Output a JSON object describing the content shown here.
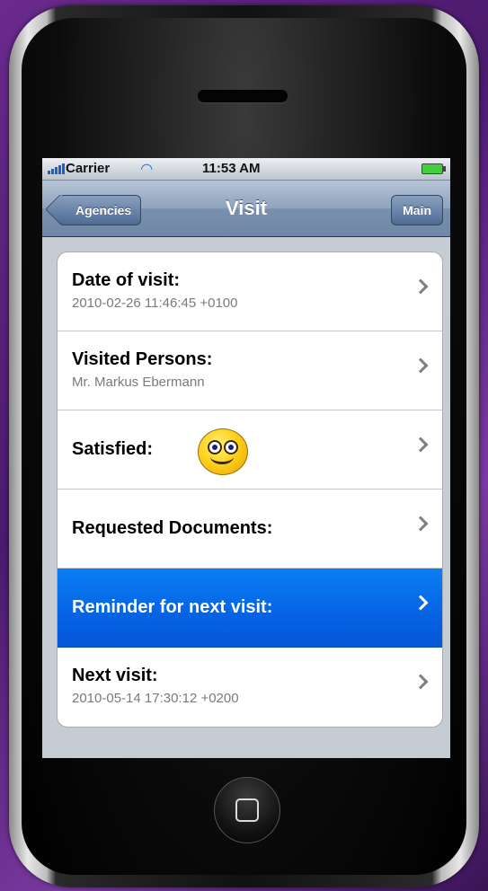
{
  "status_bar": {
    "carrier": "Carrier",
    "time": "11:53 AM",
    "wifi_icon": "wifi-icon",
    "battery_icon": "battery-icon"
  },
  "nav": {
    "title": "Visit",
    "back_label": "Agencies",
    "right_label": "Main"
  },
  "cells": [
    {
      "title": "Date of visit:",
      "subtitle": "2010-02-26 11:46:45 +0100"
    },
    {
      "title": "Visited Persons:",
      "subtitle": "Mr. Markus Ebermann"
    },
    {
      "title": "Satisfied:",
      "icon": "smiley-icon"
    },
    {
      "title": "Requested Documents:"
    },
    {
      "title": "Reminder for next visit:",
      "selected": true
    },
    {
      "title": "Next visit:",
      "subtitle": "2010-05-14 17:30:12 +0200"
    }
  ],
  "colors": {
    "selection": "#0563e3",
    "navbar": "#7990ad"
  }
}
